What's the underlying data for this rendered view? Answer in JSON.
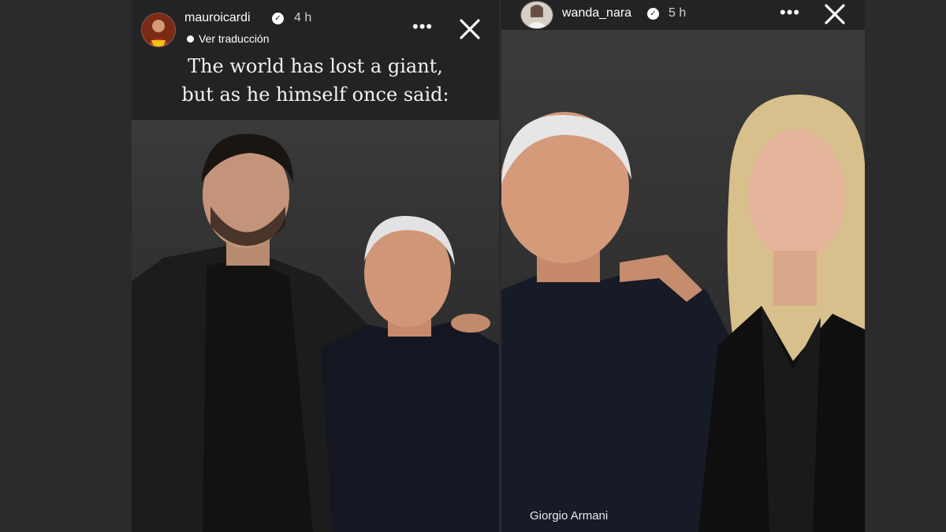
{
  "left_story": {
    "username": "mauroicardi",
    "time": "4 h",
    "translate_label": "Ver traducción",
    "caption_line1": "The world has lost a giant,",
    "caption_line2": "but as he himself once said:",
    "more_icon": "more-horizontal-icon",
    "close_icon": "close-icon"
  },
  "right_story": {
    "username": "wanda_nara",
    "time": "5 h",
    "watermark": "Giorgio Armani",
    "more_icon": "more-horizontal-icon",
    "close_icon": "close-icon"
  },
  "colors": {
    "page_bg": "#2b2b2d",
    "story_bg": "#232325",
    "text": "#ffffff"
  }
}
